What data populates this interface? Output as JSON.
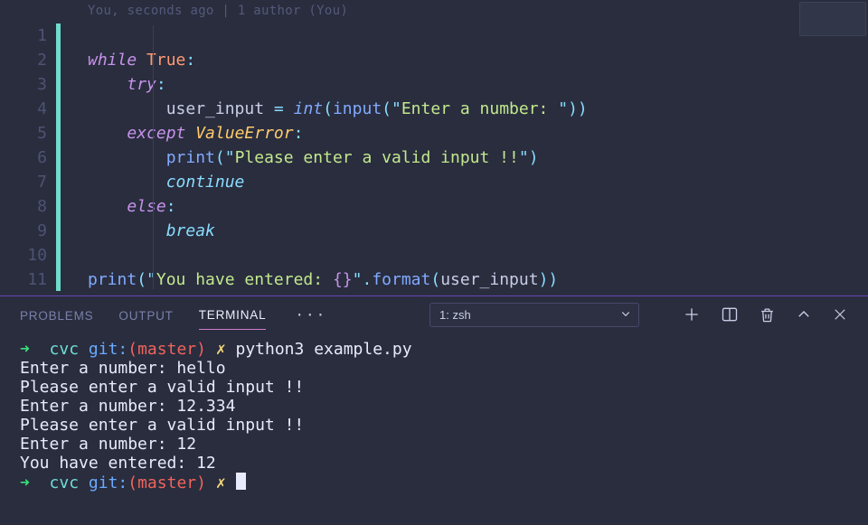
{
  "codelens": "You, seconds ago | 1 author (You)",
  "gutter": [
    "1",
    "2",
    "3",
    "4",
    "5",
    "6",
    "7",
    "8",
    "9",
    "10",
    "11"
  ],
  "code": {
    "l1": {
      "kw": "while ",
      "lit": "True",
      "colon": ":"
    },
    "l2": {
      "kw": "try",
      "colon": ":"
    },
    "l3": {
      "ident": "user_input ",
      "eq": "= ",
      "builtin": "int",
      "p1": "(",
      "fn": "input",
      "p2": "(",
      "q1": "\"",
      "str": "Enter a number: ",
      "q2": "\"",
      "p3": "))"
    },
    "l4": {
      "kw": "except ",
      "exc": "ValueError",
      "colon": ":"
    },
    "l5": {
      "fn": "print",
      "p1": "(",
      "q1": "\"",
      "str": "Please enter a valid input !!",
      "q2": "\"",
      "p2": ")"
    },
    "l6": {
      "kw": "continue"
    },
    "l7": {
      "kw": "else",
      "colon": ":"
    },
    "l8": {
      "kw": "break"
    },
    "l10": {
      "fn": "print",
      "p1": "(",
      "q1": "\"",
      "str1": "You have entered: ",
      "brace": "{}",
      "q2": "\"",
      "dot": ".",
      "fn2": "format",
      "p2": "(",
      "arg": "user_input",
      "p3": "))"
    }
  },
  "panel": {
    "tabs": {
      "problems": "PROBLEMS",
      "output": "OUTPUT",
      "terminal": "TERMINAL"
    },
    "more": "···",
    "select": "1: zsh"
  },
  "terminal": {
    "prompt": {
      "arrow": "➜",
      "path": "cvc",
      "git": "git:",
      "branch_open": "(",
      "branch": "master",
      "branch_close": ")",
      "x": "✗"
    },
    "cmd": "python3 example.py",
    "lines": [
      "Enter a number: hello",
      "Please enter a valid input !!",
      "Enter a number: 12.334",
      "Please enter a valid input !!",
      "Enter a number: 12",
      "You have entered: 12"
    ]
  }
}
